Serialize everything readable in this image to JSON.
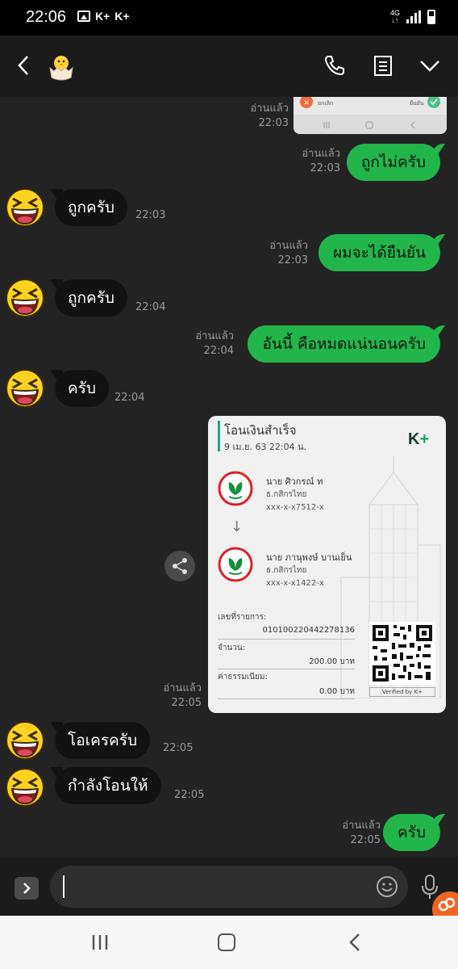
{
  "status_bar": {
    "time": "22:06",
    "app_notifications": [
      "K+",
      "K+"
    ],
    "network": "4G"
  },
  "header": {
    "contact_avatar": "chick-emoji",
    "icons": [
      "back-icon",
      "phone-icon",
      "notes-icon",
      "chevron-down-icon"
    ]
  },
  "messages": [
    {
      "type": "image-partial",
      "direction": "out",
      "read": "อ่านแล้ว",
      "time": "22:03"
    },
    {
      "type": "text",
      "direction": "out",
      "text": "ถูกไม่ครับ",
      "read": "อ่านแล้ว",
      "time": "22:03"
    },
    {
      "type": "text",
      "direction": "in",
      "text": "ถูกครับ",
      "time": "22:03"
    },
    {
      "type": "text",
      "direction": "out",
      "text": "ผมจะได้ยืนยัน",
      "read": "อ่านแล้ว",
      "time": "22:03"
    },
    {
      "type": "text",
      "direction": "in",
      "text": "ถูกครับ",
      "time": "22:04"
    },
    {
      "type": "text",
      "direction": "out",
      "text": "อันนี้ คือหมดแน่นอนครับ",
      "read": "อ่านแล้ว",
      "time": "22:04"
    },
    {
      "type": "text",
      "direction": "in",
      "text": "ครับ",
      "time": "22:04"
    },
    {
      "type": "receipt",
      "direction": "out",
      "read": "อ่านแล้ว",
      "time": "22:05"
    },
    {
      "type": "text",
      "direction": "in",
      "text": "โอเครครับ",
      "time": "22:05"
    },
    {
      "type": "text",
      "direction": "in",
      "text": "กำลังโอนให้",
      "time": "22:05"
    },
    {
      "type": "text",
      "direction": "out",
      "text": "ครับ",
      "read": "อ่านแล้ว",
      "time": "22:05"
    }
  ],
  "receipt": {
    "title": "โอนเงินสำเร็จ",
    "date": "9 เม.ย. 63  22:04 น.",
    "logo_main": "K",
    "logo_plus": "+",
    "from_name": "นาย ศิวกรณ์ ท",
    "from_bank": "ธ.กสิกรไทย",
    "from_account": "xxx-x-x7512-x",
    "to_name": "นาย ภานุพงษ์ บานเย็น",
    "to_bank": "ธ.กสิกรไทย",
    "to_account": "xxx-x-x1422-x",
    "ref_label": "เลขที่รายการ:",
    "ref_value": "010100220442278136",
    "amount_label": "จำนวน:",
    "amount_value": "200.00 บาท",
    "fee_label": "ค่าธรรมเนียม:",
    "fee_value": "0.00 บาท",
    "verified": "Verified by K+"
  },
  "preview_image": {
    "left_text": "ยกเลิก",
    "right_text": "ยืนยัน"
  },
  "colors": {
    "outgoing_bubble": "#22b64a",
    "incoming_bubble": "#121212",
    "background": "#232323",
    "accent_orange": "#f26522"
  }
}
